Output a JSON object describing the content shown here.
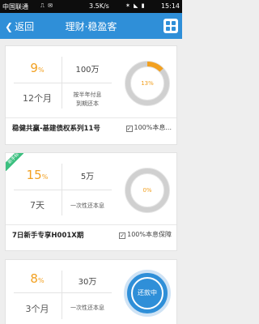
{
  "status_bar": {
    "carrier": "中国联通",
    "speed": "3.5K/s",
    "time": "15:14",
    "icons": [
      "usb-icon",
      "notification-icon",
      "wifi-icon",
      "signal-icon",
      "battery-icon"
    ]
  },
  "navbar": {
    "back_label": "返回",
    "title": "理财·稳盈客",
    "menu_icon": "grid-menu-icon",
    "color": "#2f8fd8"
  },
  "products": [
    {
      "rate_value": "9",
      "rate_unit": "%",
      "period": "12个月",
      "amount": "100万",
      "payment_line1": "按半年付息",
      "payment_line2": "到期还本",
      "progress_label": "13%",
      "progress": 0.13,
      "name": "稳健共赢-基建债权系列11号",
      "guarantee": "100%本息..."
    },
    {
      "badge": "新手标",
      "rate_value": "15",
      "rate_unit": "%",
      "period": "7天",
      "amount": "5万",
      "payment_line1": "一次性还本息",
      "progress_label": "0%",
      "progress": 0,
      "name": "7日新手专享H001X期",
      "guarantee": "100%本息保障"
    },
    {
      "rate_value": "8",
      "rate_unit": "%",
      "period": "3个月",
      "amount": "30万",
      "payment_line1": "一次性还本息",
      "status_label": "还款中"
    }
  ],
  "colors": {
    "accent": "#2f8fd8",
    "rate": "#f2a020",
    "badge": "#3bbf7f",
    "ring_track": "#d5d5d5"
  }
}
